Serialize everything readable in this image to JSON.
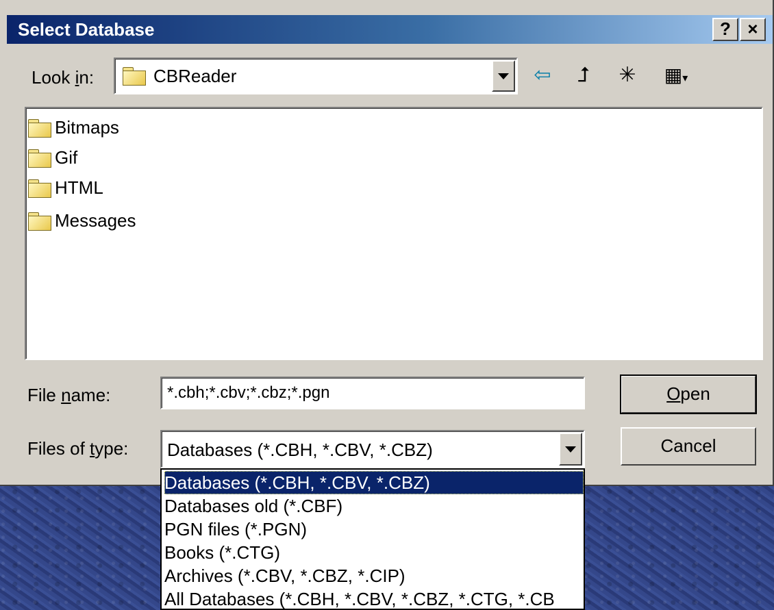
{
  "dialog": {
    "title": "Select Database",
    "help_button": "?",
    "close_button": "×"
  },
  "look_in": {
    "label_prefix": "Look ",
    "label_accel": "i",
    "label_suffix": "n:",
    "value": "CBReader"
  },
  "toolbar": {
    "back_icon": "⇦",
    "up_icon": "⮥",
    "new_folder_icon": "✳",
    "view_menu_icon": "▦"
  },
  "files": [
    {
      "name": "Bitmaps",
      "type": "folder"
    },
    {
      "name": "Gif",
      "type": "folder"
    },
    {
      "name": "HTML",
      "type": "folder"
    },
    {
      "name": "Messages",
      "type": "folder"
    }
  ],
  "file_name": {
    "label_prefix": "File ",
    "label_accel": "n",
    "label_suffix": "ame:",
    "value": "*.cbh;*.cbv;*.cbz;*.pgn"
  },
  "files_of_type": {
    "label_prefix": "Files of ",
    "label_accel": "t",
    "label_suffix": "ype:",
    "value": "Databases (*.CBH, *.CBV, *.CBZ)",
    "options": [
      "Databases (*.CBH, *.CBV, *.CBZ)",
      "Databases old (*.CBF)",
      "PGN files (*.PGN)",
      "Books (*.CTG)",
      "Archives (*.CBV, *.CBZ, *.CIP)",
      "All Databases (*.CBH, *.CBV, *.CBZ, *.CTG, *.CB"
    ],
    "selected_index": 0
  },
  "buttons": {
    "open_accel": "O",
    "open_rest": "pen",
    "cancel": "Cancel"
  },
  "colors": {
    "title_start": "#0a246a",
    "title_end": "#a6caf0",
    "face": "#d4d0c8",
    "selection": "#0a246a"
  }
}
